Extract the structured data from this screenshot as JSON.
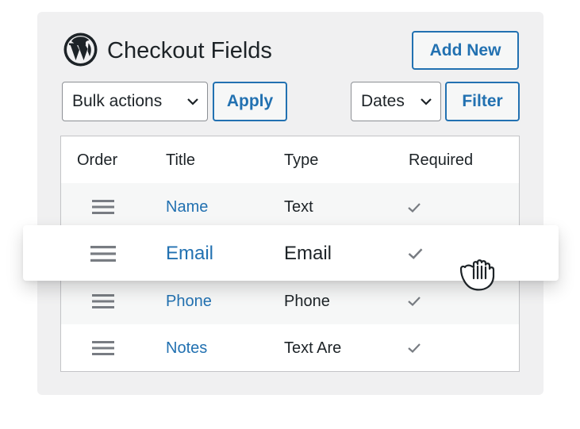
{
  "header": {
    "title": "Checkout Fields",
    "logo_icon": "wordpress-logo-icon",
    "add_new_label": "Add New"
  },
  "toolbar": {
    "bulk_actions": {
      "selected": "Bulk actions"
    },
    "apply_label": "Apply",
    "dates": {
      "selected": "Dates"
    },
    "filter_label": "Filter"
  },
  "table": {
    "columns": [
      "Order",
      "Title",
      "Type",
      "Required"
    ],
    "rows": [
      {
        "title": "Name",
        "type": "Text",
        "required": true
      },
      {
        "title": "Email",
        "type": "Email",
        "required": true,
        "dragging": true
      },
      {
        "title": "Phone",
        "type": "Phone",
        "required": true
      },
      {
        "title": "Notes",
        "type": "Text Are",
        "required": true
      }
    ]
  },
  "colors": {
    "accent": "#2271b1",
    "panel_bg": "#f0f0f1",
    "text": "#1d2327",
    "muted_icon": "#787c82"
  },
  "cursor_icon": "grab-hand-icon"
}
